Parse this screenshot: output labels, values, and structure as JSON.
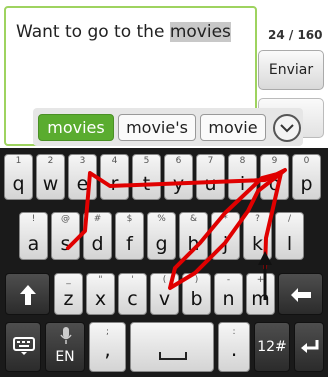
{
  "compose": {
    "text_before": "Want to go to the ",
    "text_highlight": "movies",
    "counter": "24 / 160",
    "send_label": "Enviar"
  },
  "suggestions": [
    "movies",
    "movie's",
    "movie"
  ],
  "keyboard": {
    "row1": [
      {
        "main": "q",
        "hint": "1"
      },
      {
        "main": "w",
        "hint": "2"
      },
      {
        "main": "e",
        "hint": "3"
      },
      {
        "main": "r",
        "hint": "4"
      },
      {
        "main": "t",
        "hint": "5"
      },
      {
        "main": "y",
        "hint": "6"
      },
      {
        "main": "u",
        "hint": "7"
      },
      {
        "main": "i",
        "hint": "8"
      },
      {
        "main": "o",
        "hint": "9"
      },
      {
        "main": "p",
        "hint": "0"
      }
    ],
    "row2": [
      {
        "main": "a",
        "hint": "!"
      },
      {
        "main": "s",
        "hint": "@"
      },
      {
        "main": "d",
        "hint": "#"
      },
      {
        "main": "f",
        "hint": "$"
      },
      {
        "main": "g",
        "hint": "%"
      },
      {
        "main": "h",
        "hint": "&"
      },
      {
        "main": "j",
        "hint": "*"
      },
      {
        "main": "k",
        "hint": "?"
      },
      {
        "main": "l",
        "hint": "/"
      }
    ],
    "row3": [
      {
        "main": "z",
        "hint": "_"
      },
      {
        "main": "x",
        "hint": "\""
      },
      {
        "main": "c",
        "hint": "'"
      },
      {
        "main": "v",
        "hint": "("
      },
      {
        "main": "b",
        "hint": ")"
      },
      {
        "main": "n",
        "hint": "-"
      },
      {
        "main": "m",
        "hint": "+"
      }
    ],
    "lang_label": "EN",
    "symbols_label": "12#",
    "comma_hint": ";",
    "period_hint": ":",
    "shift_icon": "shift-icon",
    "backspace_icon": "backspace-icon",
    "enter_icon": "enter-icon",
    "keyboard_icon": "keyboard-icon",
    "mic_icon": "microphone-icon",
    "space_icon": "space-icon"
  },
  "colors": {
    "accent_green": "#5aac2f",
    "gesture_red": "#e00000"
  }
}
